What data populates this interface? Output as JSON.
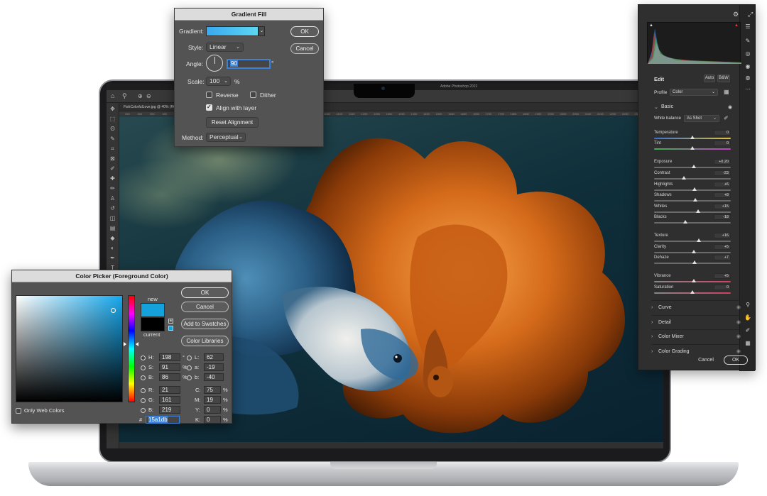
{
  "ps": {
    "menubar_title": "Adobe Photoshop 2022",
    "doc_tab": "FishColorfulLove.jpg @ 40% (RGB/8)",
    "ruler_marks": [
      "250",
      "300",
      "350",
      "400",
      "450",
      "500",
      "550",
      "600",
      "650",
      "700",
      "750",
      "800",
      "850",
      "900",
      "950",
      "1000",
      "1050",
      "1100",
      "1150",
      "1200",
      "1250",
      "1300",
      "1350",
      "1400",
      "1450",
      "1500",
      "1550",
      "1600",
      "1650",
      "1700",
      "1750",
      "1800",
      "1850",
      "1900",
      "1950",
      "2000",
      "2050",
      "2100",
      "2150",
      "2200",
      "2250",
      "2300",
      "2350",
      "2400"
    ]
  },
  "gradient_fill": {
    "title": "Gradient Fill",
    "gradient_label": "Gradient:",
    "style_label": "Style:",
    "style_value": "Linear",
    "angle_label": "Angle:",
    "angle_value": "90",
    "angle_unit": "°",
    "scale_label": "Scale:",
    "scale_value": "100",
    "scale_unit": "%",
    "reverse_label": "Reverse",
    "dither_label": "Dither",
    "align_label": "Align with layer",
    "reset_label": "Reset Alignment",
    "method_label": "Method:",
    "method_value": "Perceptual",
    "ok": "OK",
    "cancel": "Cancel",
    "gradient_colors": [
      "#3aa8f0",
      "#5dd7f2"
    ]
  },
  "color_picker": {
    "title": "Color Picker (Foreground Color)",
    "new_label": "new",
    "current_label": "current",
    "ok": "OK",
    "cancel": "Cancel",
    "add_swatches": "Add to Swatches",
    "color_libraries": "Color Libraries",
    "only_web": "Only Web Colors",
    "H": "198",
    "S": "91",
    "B": "86",
    "R": "21",
    "G": "161",
    "Bv": "219",
    "L": "62",
    "a": "-19",
    "b": "-40",
    "C": "75",
    "M": "19",
    "Y": "0",
    "K": "0",
    "hex": "15a1db",
    "deg": "°",
    "pct": "%",
    "hash": "#",
    "new_color": "#15a1db",
    "current_color": "#000000"
  },
  "acr": {
    "edit_label": "Edit",
    "auto_label": "Auto",
    "bw_label": "B&W",
    "profile_label": "Profile",
    "profile_value": "Color",
    "basic_label": "Basic",
    "wb_label": "White balance",
    "wb_value": "As Shot",
    "sliders": [
      {
        "label": "Temperature",
        "value": "0",
        "pos": 0.5
      },
      {
        "label": "Tint",
        "value": "0",
        "pos": 0.5
      },
      {
        "label": "Exposure",
        "value": "+0.20",
        "pos": 0.52
      },
      {
        "label": "Contrast",
        "value": "-23",
        "pos": 0.39
      },
      {
        "label": "Highlights",
        "value": "+6",
        "pos": 0.53
      },
      {
        "label": "Shadows",
        "value": "+8",
        "pos": 0.54
      },
      {
        "label": "Whites",
        "value": "+15",
        "pos": 0.57
      },
      {
        "label": "Blacks",
        "value": "-18",
        "pos": 0.41
      },
      {
        "label": "Texture",
        "value": "+16",
        "pos": 0.58
      },
      {
        "label": "Clarity",
        "value": "+5",
        "pos": 0.52
      },
      {
        "label": "Dehaze",
        "value": "+7",
        "pos": 0.53
      },
      {
        "label": "Vibrance",
        "value": "+5",
        "pos": 0.52
      },
      {
        "label": "Saturation",
        "value": "0",
        "pos": 0.5
      }
    ],
    "sections": [
      "Curve",
      "Detail",
      "Color Mixer",
      "Color Grading"
    ],
    "cancel": "Cancel",
    "ok": "OK"
  }
}
